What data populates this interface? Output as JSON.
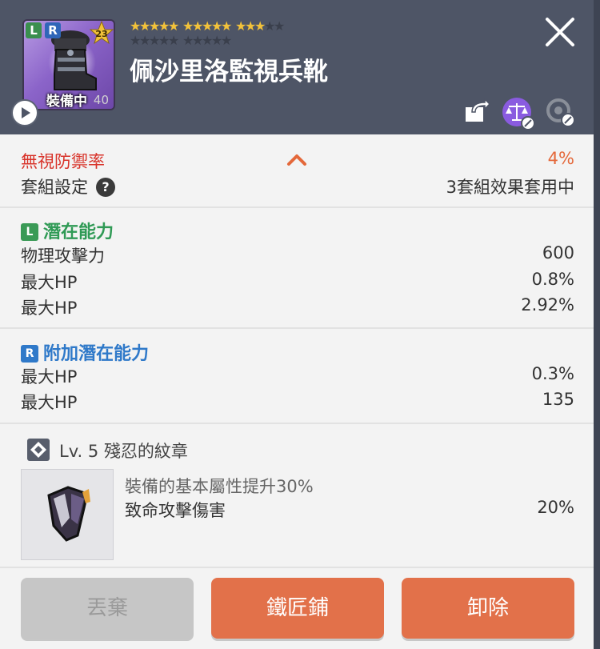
{
  "item": {
    "name": "佩沙里洛監視兵靴",
    "level_badge": "23",
    "equipped_label": "裝備中",
    "equip_number": "40",
    "potential_badge_l": "L",
    "potential_badge_r": "R",
    "star_force": 13,
    "star_max": 25
  },
  "stats": {
    "ignore_def_label": "無視防禦率",
    "ignore_def_value": "4%",
    "set_label": "套組設定",
    "set_help": "?",
    "set_value": "3套組效果套用中"
  },
  "potential": {
    "tag": "L",
    "title": "潛在能力",
    "lines": [
      {
        "label": "物理攻擊力",
        "value": "600"
      },
      {
        "label": "最大HP",
        "value": "0.8%"
      },
      {
        "label": "最大HP",
        "value": "2.92%"
      }
    ]
  },
  "additional_potential": {
    "tag": "R",
    "title": "附加潛在能力",
    "lines": [
      {
        "label": "最大HP",
        "value": "0.3%"
      },
      {
        "label": "最大HP",
        "value": "135"
      }
    ]
  },
  "emblem": {
    "title": "Lv. 5 殘忍的紋章",
    "desc": "裝備的基本屬性提升30%",
    "effect_label": "致命攻擊傷害",
    "effect_value": "20%"
  },
  "buttons": {
    "discard": "丟棄",
    "blacksmith": "鐵匠鋪",
    "unequip": "卸除"
  },
  "colors": {
    "header_bg": "#4e5566",
    "accent_orange": "#e2714a",
    "star_gold": "#f2c23a",
    "potential_green": "#2f9a55",
    "additional_blue": "#2f79c9",
    "ignore_def_red": "#d8332a"
  }
}
